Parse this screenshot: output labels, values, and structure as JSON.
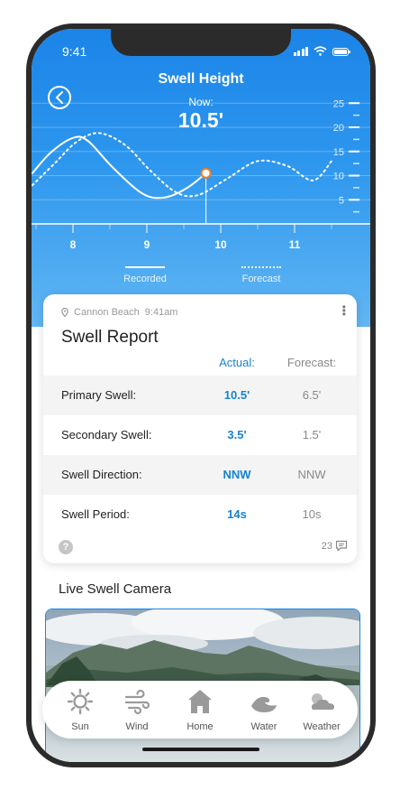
{
  "status_bar": {
    "time": "9:41"
  },
  "header": {
    "title": "Swell Height",
    "now_label": "Now:",
    "now_value": "10.5'"
  },
  "chart_data": {
    "type": "line",
    "x_ticks": [
      "8",
      "9",
      "10",
      "11"
    ],
    "y_ticks": [
      "25",
      "20",
      "15",
      "10",
      "5"
    ],
    "ylim": [
      0,
      27
    ],
    "series": [
      {
        "name": "Recorded",
        "style": "solid",
        "x": [
          7.45,
          7.7,
          8.0,
          8.2,
          8.55,
          8.95,
          9.25,
          9.55,
          9.8
        ],
        "y": [
          10.5,
          14.8,
          17.8,
          17.2,
          11.5,
          6.2,
          5.5,
          7.5,
          10.5
        ]
      },
      {
        "name": "Forecast",
        "style": "dotted",
        "x": [
          7.45,
          7.75,
          8.05,
          8.35,
          8.7,
          9.05,
          9.4,
          9.7,
          10.1,
          10.5,
          10.9,
          11.25,
          11.5
        ],
        "y": [
          8,
          12.5,
          17,
          18.8,
          16.4,
          11,
          6.5,
          6,
          9.5,
          13,
          12,
          9,
          13
        ]
      }
    ],
    "current_point": {
      "x": 9.8,
      "y": 10.5
    },
    "legend": [
      "Recorded",
      "Forecast"
    ]
  },
  "report": {
    "location": "Cannon Beach",
    "time": "9:41am",
    "title": "Swell Report",
    "col_actual": "Actual:",
    "col_forecast": "Forecast:",
    "rows": [
      {
        "label": "Primary Swell:",
        "actual": "10.5'",
        "forecast": "6.5'"
      },
      {
        "label": "Secondary Swell:",
        "actual": "3.5'",
        "forecast": "1.5'"
      },
      {
        "label": "Swell Direction:",
        "actual": "NNW",
        "forecast": "NNW"
      },
      {
        "label": "Swell Period:",
        "actual": "14s",
        "forecast": "10s"
      }
    ],
    "help": "?",
    "comment_count": "23"
  },
  "camera": {
    "title": "Live Swell Camera"
  },
  "nav": [
    {
      "label": "Sun",
      "icon": "sun-icon"
    },
    {
      "label": "Wind",
      "icon": "wind-icon"
    },
    {
      "label": "Home",
      "icon": "home-icon"
    },
    {
      "label": "Water",
      "icon": "water-icon"
    },
    {
      "label": "Weather",
      "icon": "weather-icon"
    }
  ],
  "colors": {
    "accent": "#1682d0",
    "hero": "#1b84e8",
    "current_point": "#f07c1f"
  }
}
